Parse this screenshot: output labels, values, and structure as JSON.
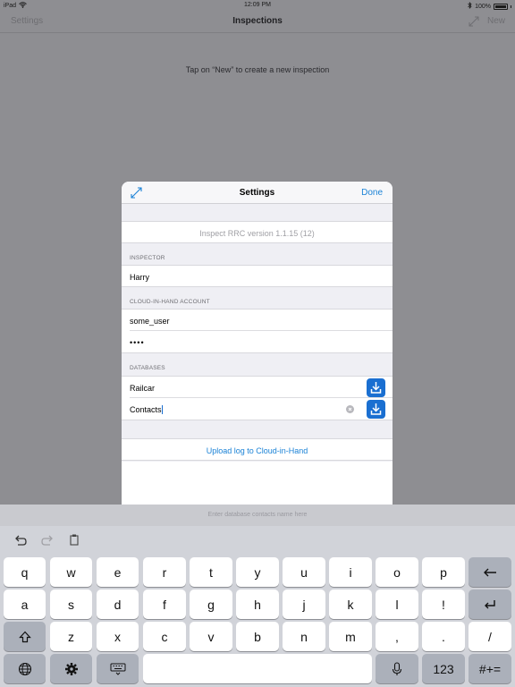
{
  "status_bar": {
    "carrier": "iPad",
    "time": "12:09 PM",
    "battery": "100%"
  },
  "nav": {
    "left": "Settings",
    "title": "Inspections",
    "right": "New"
  },
  "empty_hint": "Tap on “New” to create a new inspection",
  "settings": {
    "title": "Settings",
    "done": "Done",
    "version": "Inspect RRC version 1.1.15 (12)",
    "inspector_label": "INSPECTOR",
    "inspector_name": "Harry",
    "account_label": "CLOUD-IN-HAND ACCOUNT",
    "username": "some_user",
    "password_mask": "••••",
    "databases_label": "DATABASES",
    "databases": [
      "Railcar",
      "Contacts"
    ],
    "upload_log": "Upload log to Cloud-in-Hand"
  },
  "keyboard": {
    "hint": "Enter database contacts name here",
    "row1": [
      "q",
      "w",
      "e",
      "r",
      "t",
      "y",
      "u",
      "i",
      "o",
      "p"
    ],
    "row2": [
      "a",
      "s",
      "d",
      "f",
      "g",
      "h",
      "j",
      "k",
      "l",
      "!"
    ],
    "row3": [
      "z",
      "x",
      "c",
      "v",
      "b",
      "n",
      "m",
      ",",
      "."
    ],
    "row3_extra": "/",
    "numbers_key": "123",
    "symbols_key": "#+="
  },
  "colors": {
    "accent": "#1a82d6",
    "download_button": "#1a6fd1",
    "dim_overlay": "#8e8e92"
  },
  "icons": [
    "wifi-icon",
    "bluetooth-icon",
    "battery-icon",
    "expand-icon",
    "download-icon",
    "clear-icon",
    "undo-icon",
    "redo-icon",
    "paste-icon",
    "backspace-icon",
    "return-icon",
    "shift-icon",
    "globe-icon",
    "gear-icon",
    "keyboard-dismiss-icon",
    "dictation-icon"
  ]
}
